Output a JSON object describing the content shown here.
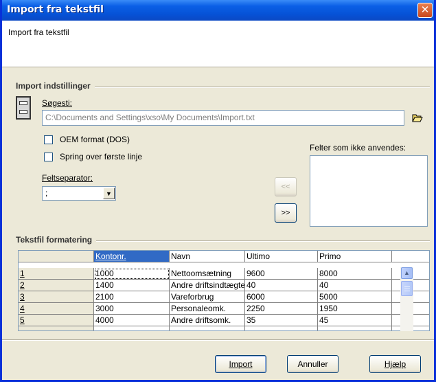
{
  "window": {
    "title": "Import fra tekstfil",
    "close_glyph": "✕"
  },
  "header": {
    "text": "Import fra tekstfil"
  },
  "import_settings": {
    "group_title": "Import indstillinger",
    "path_label": "Søgesti:",
    "path_value": "C:\\Documents and Settings\\xso\\My Documents\\Import.txt",
    "oem_label": "OEM format (DOS)",
    "oem_checked": false,
    "skip_first_line_label": "Spring over første linje",
    "skip_first_line_checked": false,
    "separator_label": "Feltseparator:",
    "separator_value": ";",
    "unused_fields_label": "Felter som ikke anvendes:",
    "move_left_label": "<<",
    "move_right_label": ">>"
  },
  "text_format": {
    "group_title": "Tekstfil formatering",
    "columns": [
      "Kontonr.",
      "Navn",
      "Ultimo",
      "Primo",
      ""
    ],
    "row_headers": [
      "1",
      "2",
      "3",
      "4",
      "5"
    ],
    "rows": [
      [
        "1000",
        "Nettoomsætning",
        "9600",
        "8000",
        ""
      ],
      [
        "1400",
        "Andre driftsindtægter",
        "40",
        "40",
        ""
      ],
      [
        "2100",
        "Vareforbrug",
        "6000",
        "5000",
        ""
      ],
      [
        "3000",
        "Personaleomk.",
        "2250",
        "1950",
        ""
      ],
      [
        "4000",
        "Andre driftsomk.",
        "35",
        "45",
        ""
      ]
    ]
  },
  "buttons": {
    "import": "Import",
    "cancel": "Annuller",
    "help": "Hjælp"
  },
  "icons": {
    "drive": "drive-icon",
    "folder": "open-folder-icon",
    "close": "close-icon"
  }
}
